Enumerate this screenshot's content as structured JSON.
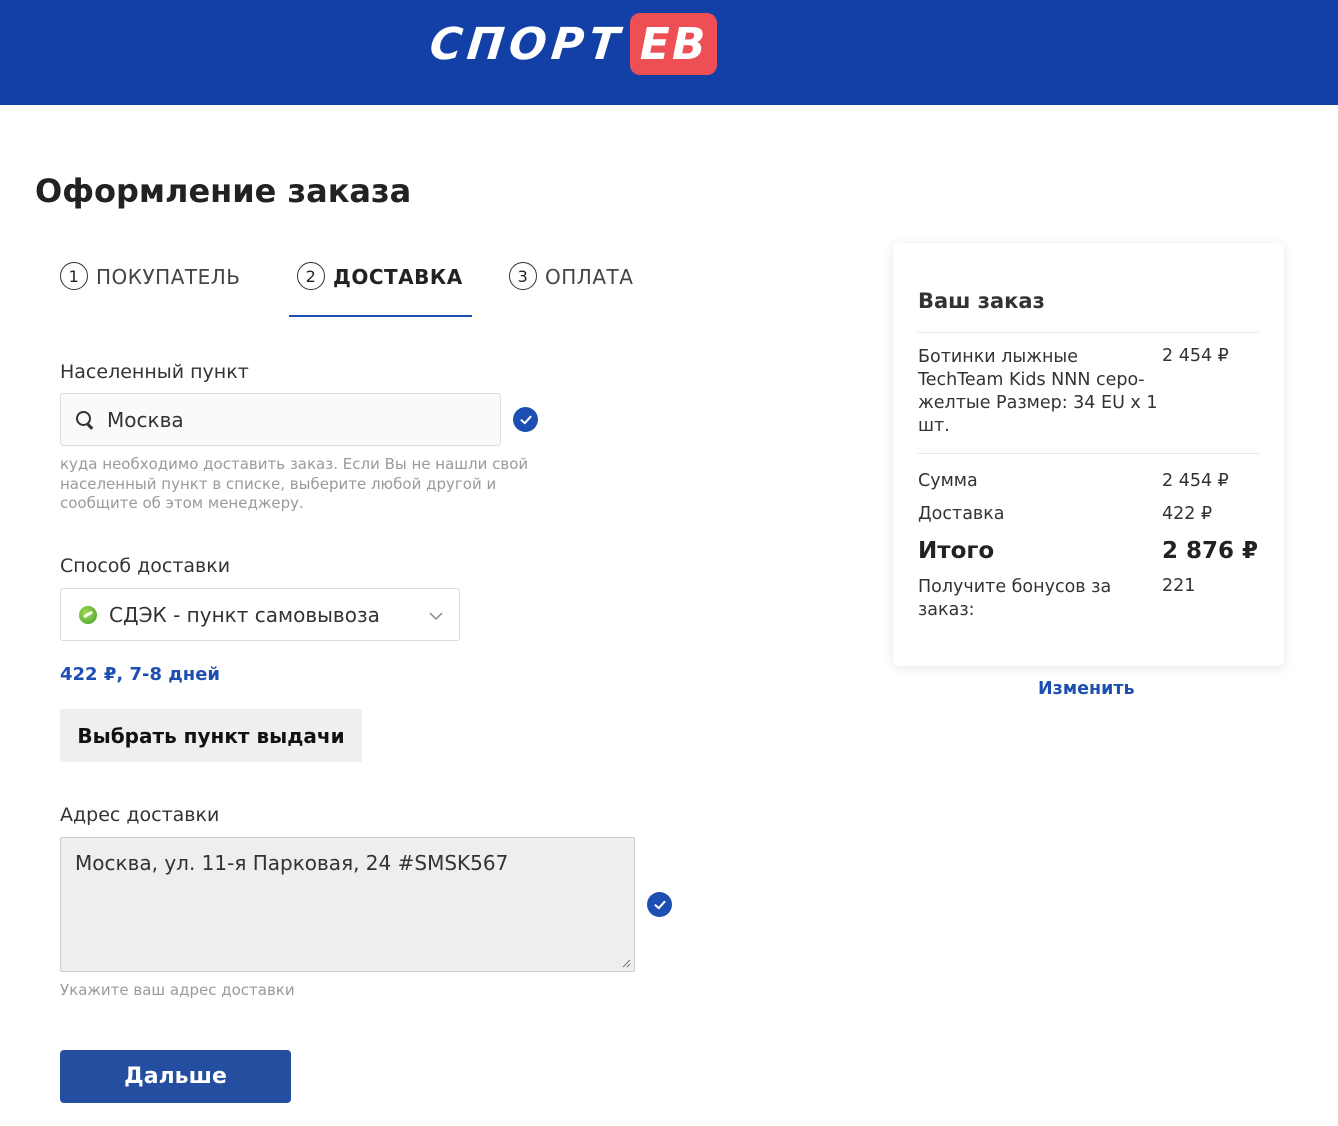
{
  "header": {
    "logo_main": "СПОРТ",
    "logo_badge": "ЕВ",
    "background_color": "#1340a6",
    "badge_color": "#ee4f55"
  },
  "page_title": "Оформление заказа",
  "steps": [
    {
      "number": "1",
      "label": "ПОКУПАТЕЛЬ",
      "active": false
    },
    {
      "number": "2",
      "label": "ДОСТАВКА",
      "active": true
    },
    {
      "number": "3",
      "label": "ОПЛАТА",
      "active": false
    }
  ],
  "city": {
    "label": "Населенный пункт",
    "value": "Москва",
    "icon": "search-icon",
    "hint": "куда необходимо доставить заказ. Если Вы не нашли свой населенный пункт в списке, выберите любой другой и сообщите об этом менеджеру.",
    "verified": true
  },
  "delivery": {
    "label": "Способ доставки",
    "selected": "СДЭК - пункт самовывоза",
    "icon": "cdek-icon",
    "price_days": "422 ₽, 7-8 дней",
    "pickup_button": "Выбрать пункт выдачи"
  },
  "address": {
    "label": "Адрес доставки",
    "value": "Москва, ул. 11-я Парковая, 24 #SMSK567",
    "hint": "Укажите ваш адрес доставки",
    "verified": true
  },
  "next_button": "Дальше",
  "order": {
    "title": "Ваш заказ",
    "item_name": "Ботинки лыжные TechTeam Kids NNN серо-желтые Размер: 34 EU x 1 шт.",
    "item_price": "2 454 ₽",
    "sum_label": "Сумма",
    "sum_value": "2 454 ₽",
    "delivery_label": "Доставка",
    "delivery_value": "422 ₽",
    "total_label": "Итого",
    "total_value": "2 876 ₽",
    "bonus_label": "Получите бонусов за заказ:",
    "bonus_value": "221",
    "change_link": "Изменить"
  },
  "colors": {
    "accent": "#1d4fb3",
    "button": "#244ea0"
  }
}
